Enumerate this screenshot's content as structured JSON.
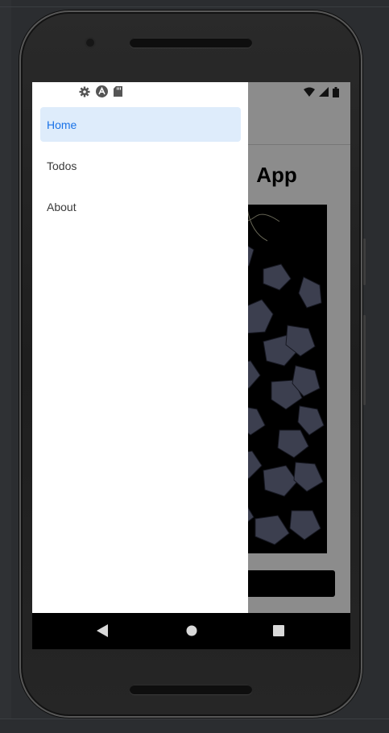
{
  "app": {
    "title_visible": "App"
  },
  "drawer": {
    "items": [
      {
        "label": "Home",
        "active": true
      },
      {
        "label": "Todos",
        "active": false
      },
      {
        "label": "About",
        "active": false
      }
    ]
  },
  "status_bar": {
    "left_icons": [
      "gear-icon",
      "a-badge-icon",
      "sd-card-icon"
    ],
    "right_icons": [
      "wifi-icon",
      "cell-signal-icon",
      "battery-icon"
    ]
  },
  "navigation_bar": {
    "buttons": [
      "back-icon",
      "home-icon",
      "recents-icon"
    ]
  },
  "colors": {
    "accent": "#1a73e8",
    "active_item_bg": "#deecfb",
    "scrim": "rgba(0,0,0,0.45)"
  }
}
